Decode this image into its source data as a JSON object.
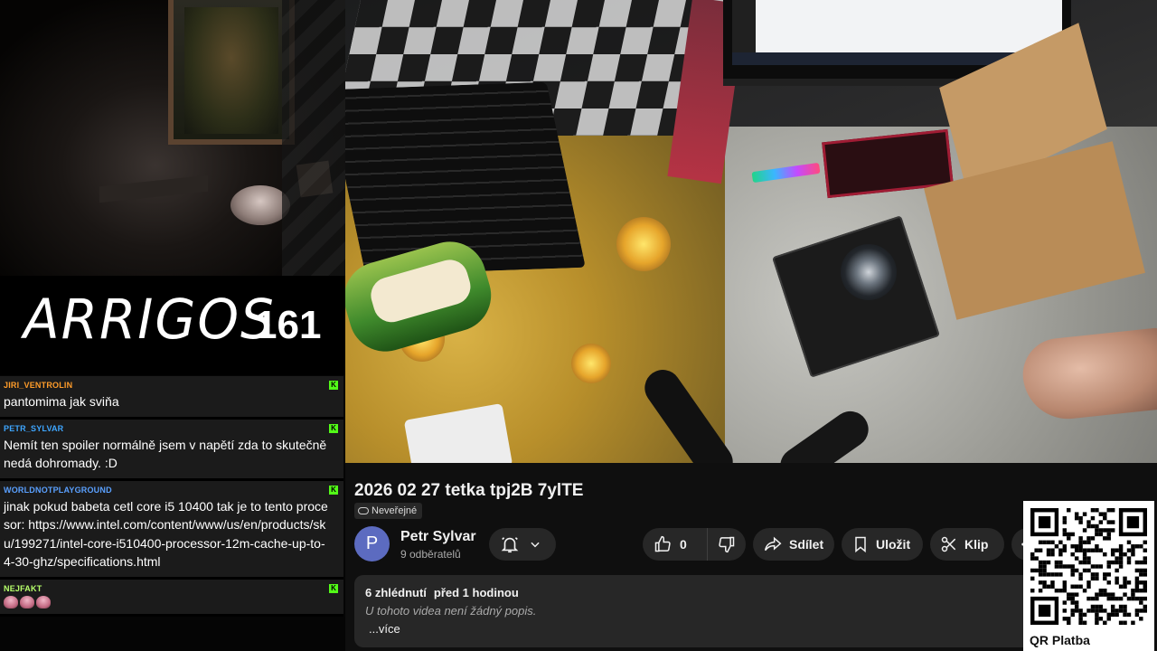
{
  "overlay": {
    "logo_text": "ARRIGOS",
    "episode_number": "161"
  },
  "chat": {
    "messages": [
      {
        "author": "JIRI_VENTROLIN",
        "author_color": "#ff9c2a",
        "text": "pantomima jak sviňa"
      },
      {
        "author": "PETR_SYLVAR",
        "author_color": "#3ea6ff",
        "text": "Nemít ten spoiler normálně jsem v napětí zda to skutečně nedá dohromady. :D"
      },
      {
        "author": "WORLDNOTPLAYGROUND",
        "author_color": "#5aa0ff",
        "text": "jinak pokud babeta cetl core i5 10400 tak je to tento procesor: https://www.intel.com/content/www/us/en/products/sku/199271/intel-core-i510400-processor-12m-cache-up-to-4-30-ghz/specifications.html"
      },
      {
        "author": "NEJFAKT",
        "author_color": "#b7ff6b",
        "text": "",
        "emotes": 3
      }
    ],
    "platform_badge": "K",
    "platform_color": "#53fc18"
  },
  "video": {
    "title": "2026 02 27 tetka tpj2B 7ylTE",
    "visibility": "Neveřejné"
  },
  "channel": {
    "avatar_letter": "P",
    "name": "Petr Sylvar",
    "subscribers": "9 odběratelů",
    "bell_icon": "bell-icon"
  },
  "actions": {
    "like_count": "0",
    "share_label": "Sdílet",
    "save_label": "Uložit",
    "clip_label": "Klip"
  },
  "description": {
    "views": "6 zhlédnutí",
    "posted": "před 1 hodinou",
    "text": "U tohoto videa není žádný popis.",
    "more": "...více"
  },
  "qr": {
    "label": "QR Platba"
  },
  "colors": {
    "youtube_bg": "#0f0f0f",
    "pill_bg": "#272727",
    "avatar": "#5c6bc0"
  }
}
